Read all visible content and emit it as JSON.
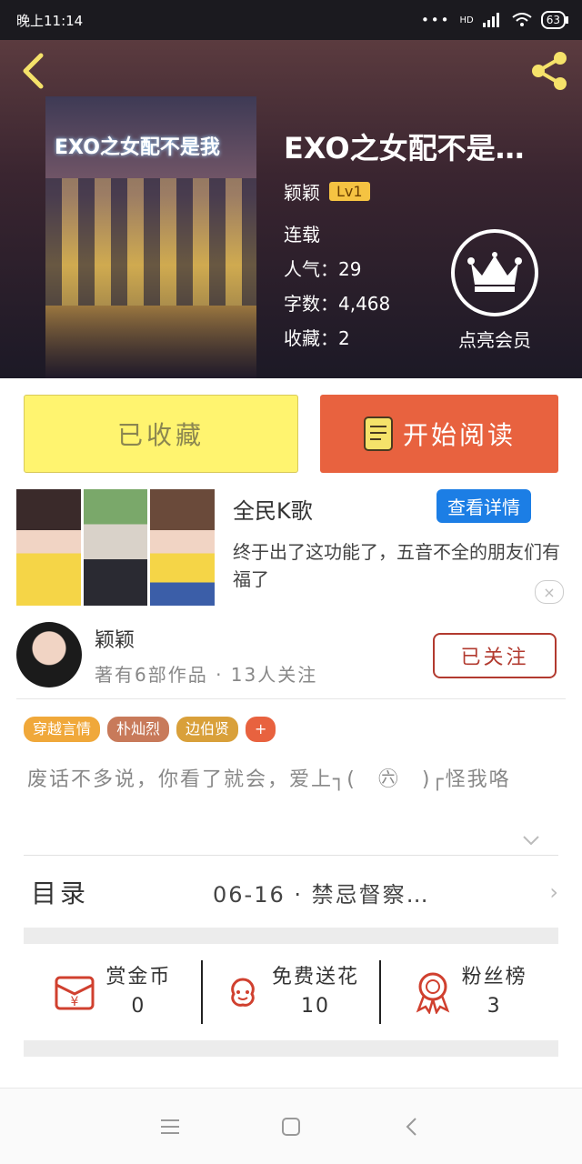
{
  "status_bar": {
    "time": "晚上11:14",
    "network": "HD",
    "battery": "63"
  },
  "book": {
    "title": "EXO之女配不是…",
    "cover_title": "EXO之女配不是我",
    "author": "颖颖",
    "level": "Lv1",
    "status": "连载",
    "popularity": "人气：29",
    "word_count": "字数：4,468",
    "favorites": "收藏：2"
  },
  "vip": {
    "label": "点亮会员"
  },
  "actions": {
    "collected_label": "已收藏",
    "read_label": "开始阅读"
  },
  "ad": {
    "title": "全民K歌",
    "detail_button": "查看详情",
    "description": "终于出了这功能了，五音不全的朋友们有福了",
    "close_symbol": "×"
  },
  "author_card": {
    "name": "颖颖",
    "stats": "著有6部作品 · 13人关注",
    "follow_label": "已关注"
  },
  "tags": [
    {
      "label": "穿越言情",
      "color": "#f0a83a"
    },
    {
      "label": "朴灿烈",
      "color": "#c87a5a"
    },
    {
      "label": "边伯贤",
      "color": "#d9a03a"
    },
    {
      "label": "+",
      "color": "#e8623f"
    }
  ],
  "intro": "废话不多说，你看了就会，爱上┐(　㊅　)┌怪我咯",
  "toc": {
    "label": "目录",
    "latest": "06-16 · 禁忌督察…"
  },
  "stats": [
    {
      "label": "赏金币",
      "value": "0",
      "icon": "coin-envelope-icon"
    },
    {
      "label": "免费送花",
      "value": "10",
      "icon": "flower-icon"
    },
    {
      "label": "粉丝榜",
      "value": "3",
      "icon": "medal-icon"
    }
  ],
  "colors": {
    "accent_orange": "#e8623f",
    "collect_yellow": "#fff46f",
    "detail_blue": "#1c7ee5",
    "follow_red": "#b23a2f"
  }
}
